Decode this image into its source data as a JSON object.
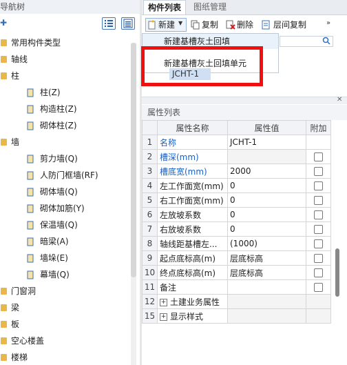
{
  "nav": {
    "title": "导航树",
    "items": [
      {
        "label": "常用构件类型",
        "level": 0
      },
      {
        "label": "轴线",
        "level": 0
      },
      {
        "label": "柱",
        "level": 0
      },
      {
        "label": "柱(Z)",
        "level": 1,
        "icon": "column-icon"
      },
      {
        "label": "构造柱(Z)",
        "level": 1,
        "icon": "construction-column-icon"
      },
      {
        "label": "砌体柱(Z)",
        "level": 1,
        "icon": "masonry-column-icon"
      },
      {
        "label": "墙",
        "level": 0
      },
      {
        "label": "剪力墙(Q)",
        "level": 1,
        "icon": "shear-wall-icon"
      },
      {
        "label": "人防门框墙(RF)",
        "level": 1,
        "icon": "civil-defense-door-wall-icon"
      },
      {
        "label": "砌体墙(Q)",
        "level": 1,
        "icon": "masonry-wall-icon"
      },
      {
        "label": "砌体加筋(Y)",
        "level": 1,
        "icon": "masonry-reinforcement-icon"
      },
      {
        "label": "保温墙(Q)",
        "level": 1,
        "icon": "insulation-wall-icon"
      },
      {
        "label": "暗梁(A)",
        "level": 1,
        "icon": "hidden-beam-icon"
      },
      {
        "label": "墙垛(E)",
        "level": 1,
        "icon": "wall-pier-icon"
      },
      {
        "label": "幕墙(Q)",
        "level": 1,
        "icon": "curtain-wall-icon"
      },
      {
        "label": "门窗洞",
        "level": 0
      },
      {
        "label": "梁",
        "level": 0
      },
      {
        "label": "板",
        "level": 0
      },
      {
        "label": "空心楼盖",
        "level": 0
      },
      {
        "label": "楼梯",
        "level": 0
      }
    ]
  },
  "tabs": {
    "active": "构件列表",
    "second": "图纸管理"
  },
  "toolbar": {
    "new_label": "新建",
    "copy_label": "复制",
    "delete_label": "删除",
    "floor_copy_label": "层间复制"
  },
  "menu": {
    "item1": "新建基槽灰土回填",
    "item2": "新建基槽灰土回填单元"
  },
  "component": {
    "name": "JCHT-1"
  },
  "props": {
    "title": "属性列表",
    "headers": [
      "属性名称",
      "属性值",
      "附加"
    ],
    "rows": [
      {
        "num": "1",
        "name": "名称",
        "value": "JCHT-1",
        "blue": true,
        "check": false,
        "grey": false
      },
      {
        "num": "2",
        "name": "槽深(mm)",
        "value": "",
        "blue": true,
        "check": true,
        "grey": true
      },
      {
        "num": "3",
        "name": "槽底宽(mm)",
        "value": "2000",
        "blue": true,
        "check": true,
        "grey": false
      },
      {
        "num": "4",
        "name": "左工作面宽(mm)",
        "value": "0",
        "blue": false,
        "check": true,
        "grey": false
      },
      {
        "num": "5",
        "name": "右工作面宽(mm)",
        "value": "0",
        "blue": false,
        "check": true,
        "grey": false
      },
      {
        "num": "6",
        "name": "左放坡系数",
        "value": "0",
        "blue": false,
        "check": true,
        "grey": false
      },
      {
        "num": "7",
        "name": "右放坡系数",
        "value": "0",
        "blue": false,
        "check": true,
        "grey": false
      },
      {
        "num": "8",
        "name": "轴线距基槽左...",
        "value": "(1000)",
        "blue": false,
        "check": true,
        "grey": false
      },
      {
        "num": "9",
        "name": "起点底标高(m)",
        "value": "层底标高",
        "blue": false,
        "check": true,
        "grey": false
      },
      {
        "num": "10",
        "name": "终点底标高(m)",
        "value": "层底标高",
        "blue": false,
        "check": true,
        "grey": false
      },
      {
        "num": "11",
        "name": "备注",
        "value": "",
        "blue": false,
        "check": true,
        "grey": false
      },
      {
        "num": "12",
        "name": "土建业务属性",
        "value": "",
        "blue": false,
        "check": false,
        "grey": true,
        "expand": true
      },
      {
        "num": "15",
        "name": "显示样式",
        "value": "",
        "blue": false,
        "check": false,
        "grey": true,
        "expand": true
      }
    ]
  },
  "colors": {
    "highlight_box": "#f01010",
    "link_blue": "#1a5fc2",
    "folder": "#e8b84b"
  }
}
